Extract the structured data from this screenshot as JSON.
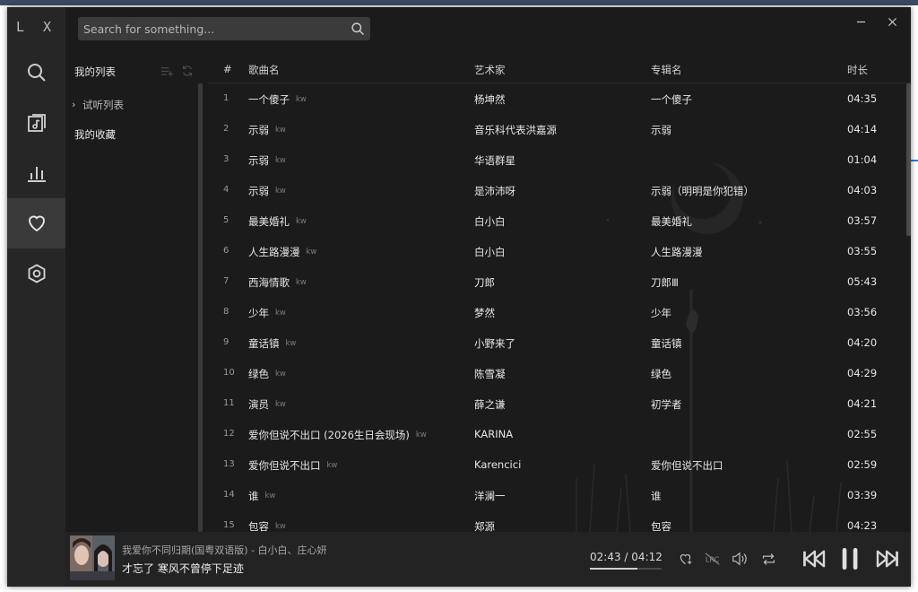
{
  "app": {
    "logo": "L X",
    "accent": "#3a3a3a",
    "icons": [
      "search-icon",
      "music-note-icon",
      "bar-chart-icon",
      "heart-icon",
      "settings-icon"
    ]
  },
  "search": {
    "placeholder": "Search for something...",
    "value": ""
  },
  "lists": {
    "title": "我的列表",
    "items": [
      {
        "label": "试听列表",
        "expandable": true
      },
      {
        "label": "我的收藏",
        "expandable": false
      }
    ]
  },
  "table": {
    "headers": {
      "num": "#",
      "name": "歌曲名",
      "artist": "艺术家",
      "album": "专辑名",
      "duration": "时长"
    },
    "rows": [
      {
        "num": "1",
        "name": "一个傻子",
        "source": "kw",
        "artist": "杨坤然",
        "album": "一个傻子",
        "duration": "04:35"
      },
      {
        "num": "2",
        "name": "示弱",
        "source": "kw",
        "artist": "音乐科代表洪嘉源",
        "album": "示弱",
        "duration": "04:14"
      },
      {
        "num": "3",
        "name": "示弱",
        "source": "kw",
        "artist": "华语群星",
        "album": "",
        "duration": "01:04"
      },
      {
        "num": "4",
        "name": "示弱",
        "source": "kw",
        "artist": "是沛沛呀",
        "album": "示弱（明明是你犯错）",
        "duration": "04:03"
      },
      {
        "num": "5",
        "name": "最美婚礼",
        "source": "kw",
        "artist": "白小白",
        "album": "最美婚礼",
        "duration": "03:57"
      },
      {
        "num": "6",
        "name": "人生路漫漫",
        "source": "kw",
        "artist": "白小白",
        "album": "人生路漫漫",
        "duration": "03:55"
      },
      {
        "num": "7",
        "name": "西海情歌",
        "source": "kw",
        "artist": "刀郎",
        "album": "刀郎Ⅲ",
        "duration": "05:43"
      },
      {
        "num": "8",
        "name": "少年",
        "source": "kw",
        "artist": "梦然",
        "album": "少年",
        "duration": "03:56"
      },
      {
        "num": "9",
        "name": "童话镇",
        "source": "kw",
        "artist": "小野来了",
        "album": "童话镇",
        "duration": "04:20"
      },
      {
        "num": "10",
        "name": "绿色",
        "source": "kw",
        "artist": "陈雪凝",
        "album": "绿色",
        "duration": "04:29"
      },
      {
        "num": "11",
        "name": "演员",
        "source": "kw",
        "artist": "薛之谦",
        "album": "初学者",
        "duration": "04:21"
      },
      {
        "num": "12",
        "name": "爱你但说不出口 (2026生日会现场)",
        "source": "kw",
        "artist": "KARINA",
        "album": "",
        "duration": "02:55"
      },
      {
        "num": "13",
        "name": "爱你但说不出口",
        "source": "kw",
        "artist": "Karencici",
        "album": "爱你但说不出口",
        "duration": "02:59"
      },
      {
        "num": "14",
        "name": "谁",
        "source": "kw",
        "artist": "洋澜一",
        "album": "谁",
        "duration": "03:39"
      },
      {
        "num": "15",
        "name": "包容",
        "source": "kw",
        "artist": "郑源",
        "album": "包容",
        "duration": "04:23"
      }
    ]
  },
  "player": {
    "title": "我爱你不同归期(国粤双语版) - 白小白、庄心妍",
    "lyric": "才忘了 寒风不曾停下足迹",
    "current": "02:43",
    "separator": "/",
    "total": "04:12",
    "progress_fraction": 0.66
  }
}
